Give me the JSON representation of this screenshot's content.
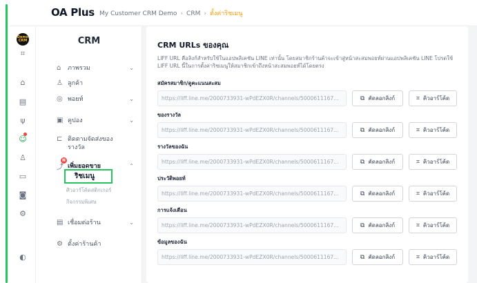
{
  "header": {
    "logo": "OA Plus",
    "breadcrumb": [
      "My Customer CRM Demo",
      "CRM",
      "ตั้งค่าริชเมนู"
    ]
  },
  "rail": {
    "brand_text": "Demo CRM",
    "icons": [
      "qr-grid-icon",
      "tag-icon",
      "chat-icon",
      "bowl-icon",
      "person-heart-icon",
      "user-icon",
      "card-icon",
      "robot-icon",
      "gear-icon",
      "help-icon"
    ]
  },
  "sidebar": {
    "title": "CRM",
    "items": [
      {
        "label": "ภาพรวม",
        "icon": "home-icon"
      },
      {
        "label": "ลูกค้า",
        "icon": "users-icon"
      },
      {
        "label": "พอยท์",
        "icon": "coin-icon"
      },
      {
        "label": "คูปอง",
        "icon": "coupon-icon"
      },
      {
        "label": "ติดตามจัดส่งของ",
        "label2": "รางวัล",
        "icon": "truck-icon"
      },
      {
        "label": "เพิ่มยอดขาย",
        "icon": "trend-icon",
        "badge": "N"
      },
      {
        "label": "เชื่อมต่อร้าน",
        "icon": "store-icon"
      },
      {
        "label": "ตั้งค่าร้านค้า",
        "icon": "settings-icon"
      }
    ],
    "subitems": [
      "ริชเมนู",
      "ศิวอาร์โค้ดสติกเกอร์",
      "กิจกรรมพิเศษ"
    ]
  },
  "main": {
    "title": "CRM URLs ของคุณ",
    "description": "LIFF URL คือลิงก์สำหรับใช้ในแอปพลิเคชัน LINE เท่านั้น โดยสมาชิกร้านค้าจะเข้าสู่หน้าสะสมพอยท์ผ่านแอปพลิเคชัน LINE โปรดใช้ LIFF URL นี้ในการตั้งค่าริชเมนูให้สมาชิกเข้าถึงหน้าสะสมพอยท์ได้โดยตรง",
    "copy_label": "คัดลอกลิงก์",
    "qr_label": "คิวอาร์โค้ด",
    "rows": [
      {
        "label": "สมัครสมาชิก/ดูคะแนนสะสม",
        "url": "https://liff.line.me/2000733931-wPdEZX0R/channels/5000611167..."
      },
      {
        "label": "ของรางวัล",
        "url": "https://liff.line.me/2000733931-wPdEZX0R/channels/5000611167..."
      },
      {
        "label": "รางวัลของฉัน",
        "url": "https://liff.line.me/2000733931-wPdEZX0R/channels/5000611167..."
      },
      {
        "label": "ประวัติพอยท์",
        "url": "https://liff.line.me/2000733931-wPdEZX0R/channels/5000611167..."
      },
      {
        "label": "การแจ้งเตือน",
        "url": "https://liff.line.me/2000733931-wPdEZX0R/channels/5000611167..."
      },
      {
        "label": "ข้อมูลของฉัน",
        "url": "https://liff.line.me/2000733931-wPdEZX0R/channels/5000611167..."
      }
    ]
  }
}
